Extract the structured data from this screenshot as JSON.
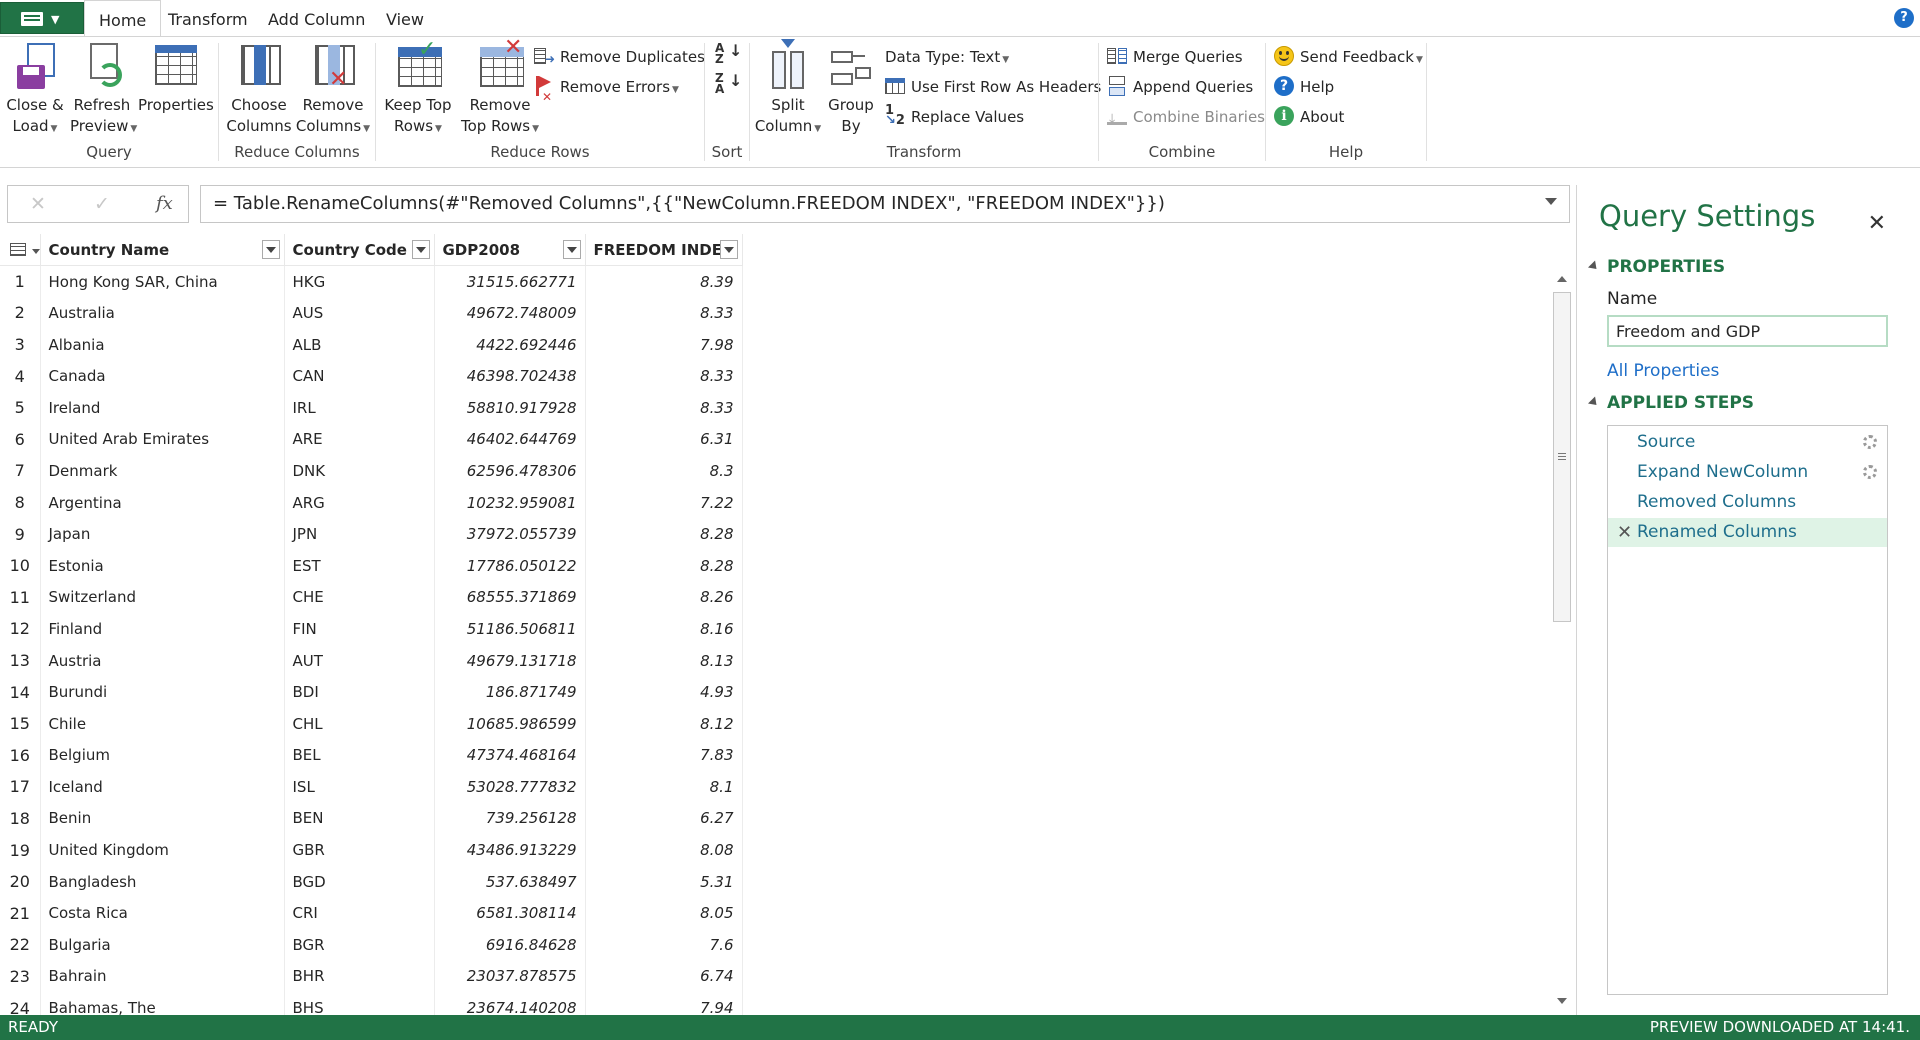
{
  "tabs": [
    {
      "label": "Home",
      "active": true
    },
    {
      "label": "Transform",
      "active": false
    },
    {
      "label": "Add Column",
      "active": false
    },
    {
      "label": "View",
      "active": false
    }
  ],
  "ribbon": {
    "query": {
      "label": "Query",
      "close_load": [
        "Close &",
        "Load"
      ],
      "refresh_preview": [
        "Refresh",
        "Preview"
      ],
      "properties": "Properties"
    },
    "reduce_columns": {
      "label": "Reduce Columns",
      "choose_columns": [
        "Choose",
        "Columns"
      ],
      "remove_columns": [
        "Remove",
        "Columns"
      ]
    },
    "reduce_rows": {
      "label": "Reduce Rows",
      "keep_top_rows": [
        "Keep Top",
        "Rows"
      ],
      "remove_top_rows": [
        "Remove",
        "Top Rows"
      ],
      "remove_duplicates": "Remove Duplicates",
      "remove_errors": "Remove Errors"
    },
    "sort": {
      "label": "Sort"
    },
    "transform": {
      "label": "Transform",
      "split_column": [
        "Split",
        "Column"
      ],
      "group_by": [
        "Group",
        "By"
      ],
      "data_type": "Data Type: Text",
      "first_row_headers": "Use First Row As Headers",
      "replace_values": "Replace Values"
    },
    "combine": {
      "label": "Combine",
      "merge_queries": "Merge Queries",
      "append_queries": "Append Queries",
      "combine_binaries": "Combine Binaries"
    },
    "help": {
      "label": "Help",
      "send_feedback": "Send Feedback",
      "help": "Help",
      "about": "About"
    }
  },
  "formula": {
    "text": "= Table.RenameColumns(#\"Removed Columns\",{{\"NewColumn.FREEDOM INDEX\", \"FREEDOM INDEX\"}})",
    "cancel": "✕",
    "confirm": "✓",
    "fx": "fx"
  },
  "columns": [
    "Country Name",
    "Country Code",
    "GDP2008",
    "FREEDOM INDEX"
  ],
  "rows": [
    [
      "1",
      "Hong Kong SAR, China",
      "HKG",
      "31515.662771",
      "8.39"
    ],
    [
      "2",
      "Australia",
      "AUS",
      "49672.748009",
      "8.33"
    ],
    [
      "3",
      "Albania",
      "ALB",
      "4422.692446",
      "7.98"
    ],
    [
      "4",
      "Canada",
      "CAN",
      "46398.702438",
      "8.33"
    ],
    [
      "5",
      "Ireland",
      "IRL",
      "58810.917928",
      "8.33"
    ],
    [
      "6",
      "United Arab Emirates",
      "ARE",
      "46402.644769",
      "6.31"
    ],
    [
      "7",
      "Denmark",
      "DNK",
      "62596.478306",
      "8.3"
    ],
    [
      "8",
      "Argentina",
      "ARG",
      "10232.959081",
      "7.22"
    ],
    [
      "9",
      "Japan",
      "JPN",
      "37972.055739",
      "8.28"
    ],
    [
      "10",
      "Estonia",
      "EST",
      "17786.050122",
      "8.28"
    ],
    [
      "11",
      "Switzerland",
      "CHE",
      "68555.371869",
      "8.26"
    ],
    [
      "12",
      "Finland",
      "FIN",
      "51186.506811",
      "8.16"
    ],
    [
      "13",
      "Austria",
      "AUT",
      "49679.131718",
      "8.13"
    ],
    [
      "14",
      "Burundi",
      "BDI",
      "186.871749",
      "4.93"
    ],
    [
      "15",
      "Chile",
      "CHL",
      "10685.986599",
      "8.12"
    ],
    [
      "16",
      "Belgium",
      "BEL",
      "47374.468164",
      "7.83"
    ],
    [
      "17",
      "Iceland",
      "ISL",
      "53028.777832",
      "8.1"
    ],
    [
      "18",
      "Benin",
      "BEN",
      "739.256128",
      "6.27"
    ],
    [
      "19",
      "United Kingdom",
      "GBR",
      "43486.913229",
      "8.08"
    ],
    [
      "20",
      "Bangladesh",
      "BGD",
      "537.638497",
      "5.31"
    ],
    [
      "21",
      "Costa Rica",
      "CRI",
      "6581.308114",
      "8.05"
    ],
    [
      "22",
      "Bulgaria",
      "BGR",
      "6916.84628",
      "7.6"
    ],
    [
      "23",
      "Bahrain",
      "BHR",
      "23037.878575",
      "6.74"
    ],
    [
      "24",
      "Bahamas, The",
      "BHS",
      "23674.140208",
      "7.94"
    ]
  ],
  "query_settings": {
    "title": "Query Settings",
    "close": "✕",
    "properties_heading": "PROPERTIES",
    "name_label": "Name",
    "name_value": "Freedom and GDP",
    "all_properties": "All Properties",
    "applied_steps_heading": "APPLIED STEPS",
    "steps": [
      {
        "label": "Source",
        "has_gear": true,
        "selected": false
      },
      {
        "label": "Expand NewColumn",
        "has_gear": true,
        "selected": false
      },
      {
        "label": "Removed Columns",
        "has_gear": false,
        "selected": false
      },
      {
        "label": "Renamed Columns",
        "has_gear": false,
        "selected": true
      }
    ]
  },
  "status": {
    "left": "READY",
    "right": "PREVIEW DOWNLOADED AT 14:41."
  },
  "colors": {
    "accent": "#217346",
    "link": "#1e6ec8",
    "selected_step": "#dff3e6"
  }
}
